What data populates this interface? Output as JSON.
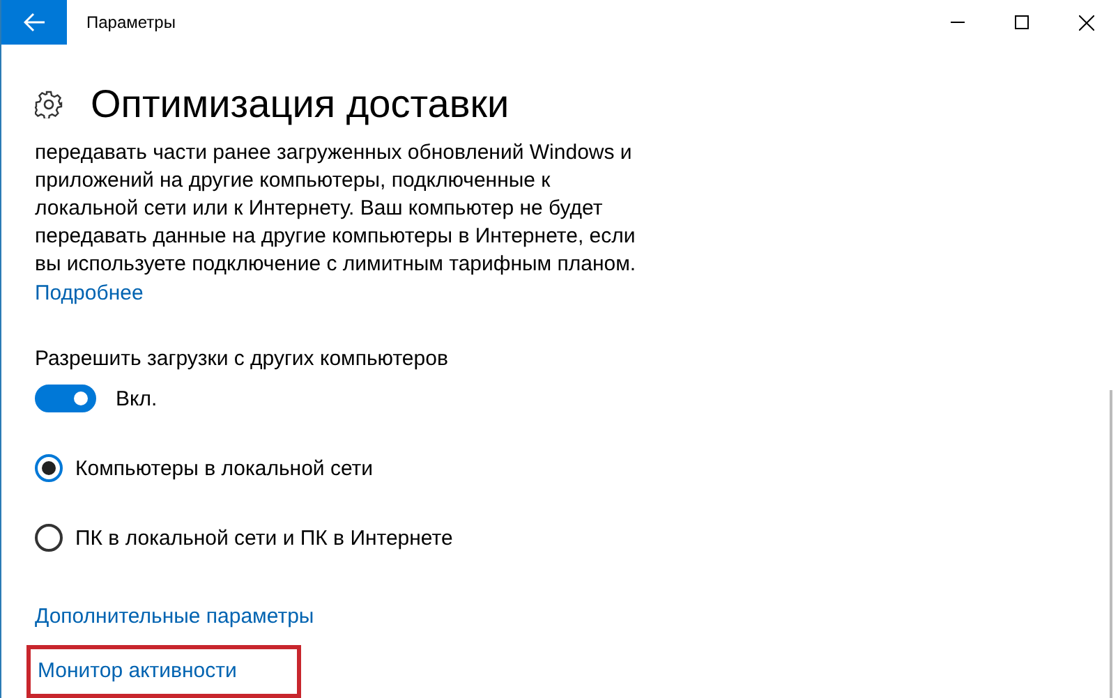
{
  "window": {
    "title": "Параметры"
  },
  "page": {
    "title": "Оптимизация доставки"
  },
  "description": "передавать части ранее загруженных обновлений Windows и приложений на другие компьютеры, подключенные к локальной сети или к Интернету. Ваш компьютер не будет передавать данные на другие компьютеры в Интернете, если вы используете подключение с лимитным тарифным планом.",
  "more_link": "Подробнее",
  "toggle": {
    "label": "Разрешить загрузки с других компьютеров",
    "on": true,
    "state_text": "Вкл."
  },
  "radios": [
    {
      "label": "Компьютеры в локальной сети",
      "selected": true
    },
    {
      "label": "ПК в локальной сети и ПК в Интернете",
      "selected": false
    }
  ],
  "links": [
    {
      "label": "Дополнительные параметры",
      "highlighted": false
    },
    {
      "label": "Монитор активности",
      "highlighted": true
    }
  ]
}
